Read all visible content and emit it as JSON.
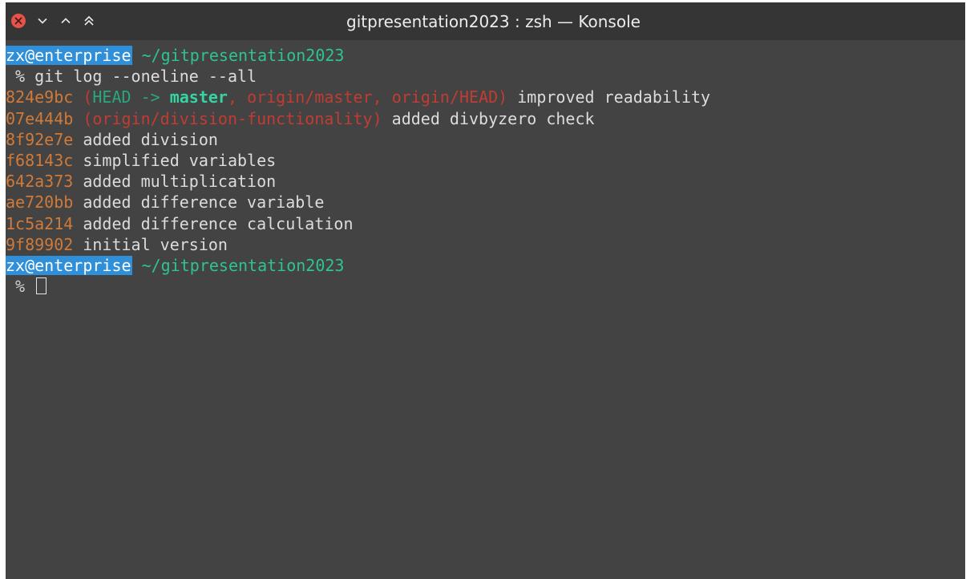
{
  "window": {
    "title": "gitpresentation2023 : zsh — Konsole",
    "buttons": {
      "close": "close-icon",
      "minimize": "chevron-down-icon",
      "maximize": "chevron-up-icon",
      "keep_above": "double-chevron-up-icon"
    },
    "colors": {
      "close": "#e5534b",
      "background": "#434343",
      "titlebar": "#353535"
    }
  },
  "terminal": {
    "prompt1": {
      "user": "zx@enterprise",
      "path": " ~/gitpresentation2023"
    },
    "command": " % git log --oneline --all",
    "log": [
      {
        "hash": "824e9bc",
        "open": " (",
        "head": "HEAD -> ",
        "local": "master",
        "sep1": ", ",
        "remote1": "origin/master",
        "sep2": ", ",
        "remote2": "origin/HEAD",
        "close": ")",
        "message": " improved readability"
      },
      {
        "hash": "07e444b",
        "open": " (",
        "remote1": "origin/division-functionality",
        "close": ")",
        "message": " added divbyzero check"
      },
      {
        "hash": "8f92e7e",
        "message": " added division"
      },
      {
        "hash": "f68143c",
        "message": " simplified variables"
      },
      {
        "hash": "642a373",
        "message": " added multiplication"
      },
      {
        "hash": "ae720bb",
        "message": " added difference variable"
      },
      {
        "hash": "1c5a214",
        "message": " added difference calculation"
      },
      {
        "hash": "9f89902",
        "message": " initial version"
      }
    ],
    "prompt2": {
      "user": "zx@enterprise",
      "path": " ~/gitpresentation2023",
      "symbol": " % "
    }
  }
}
